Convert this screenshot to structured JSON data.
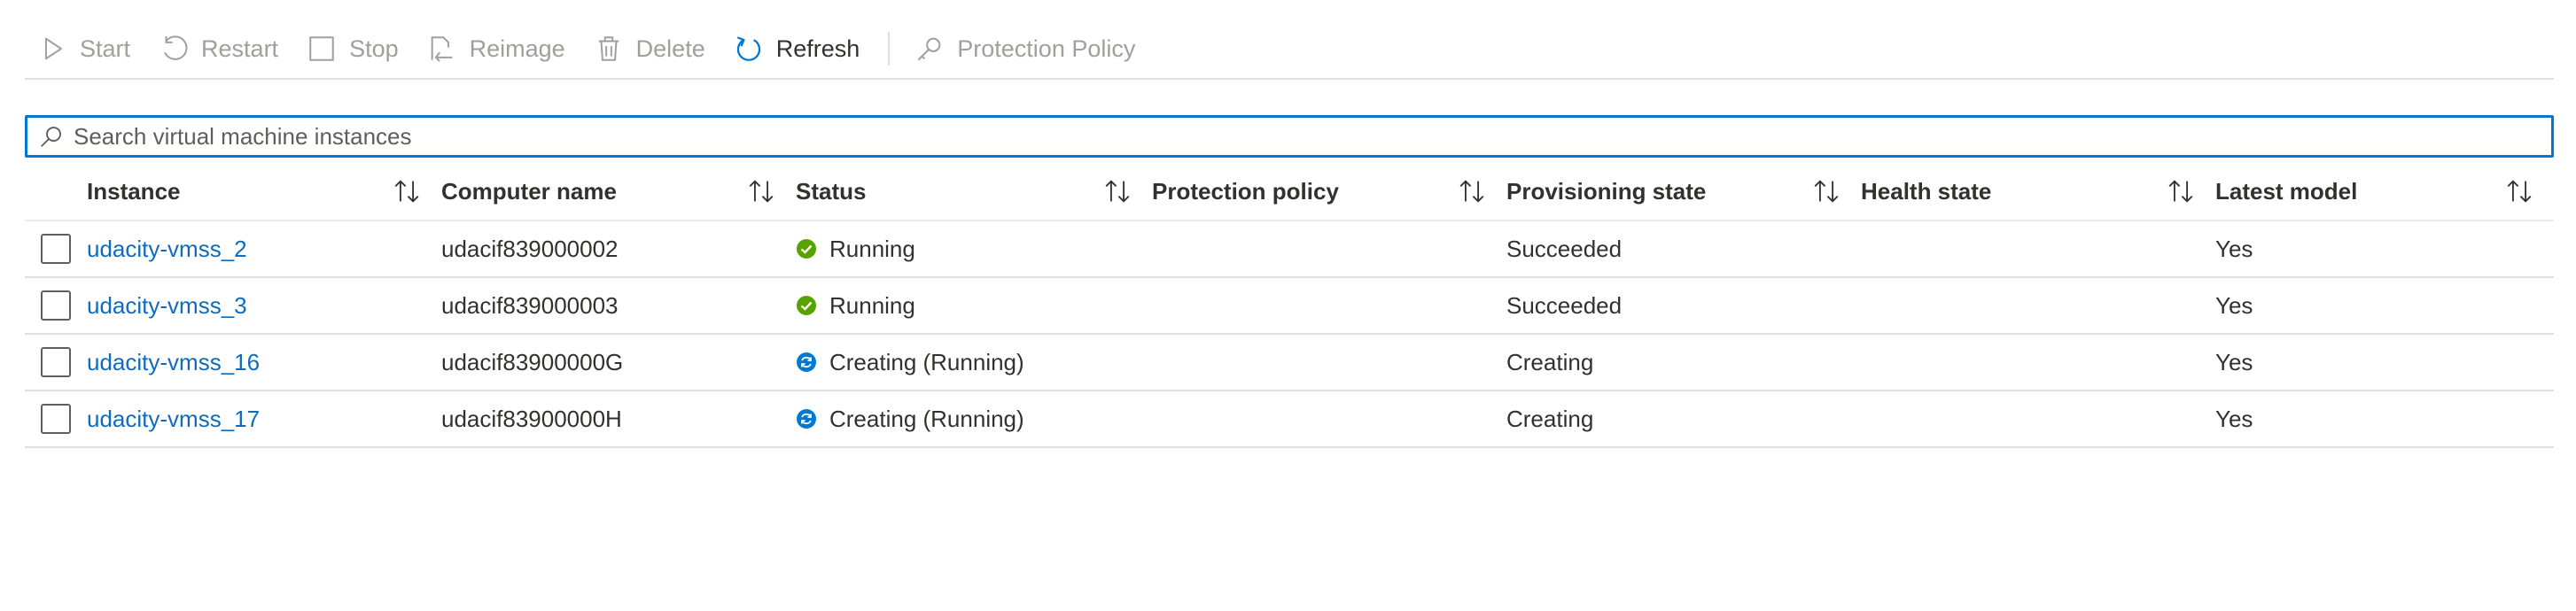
{
  "toolbar": {
    "start": "Start",
    "restart": "Restart",
    "stop": "Stop",
    "reimage": "Reimage",
    "delete": "Delete",
    "refresh": "Refresh",
    "protection_policy": "Protection Policy"
  },
  "search": {
    "placeholder": "Search virtual machine instances",
    "value": ""
  },
  "table": {
    "headers": {
      "instance": "Instance",
      "computer_name": "Computer name",
      "status": "Status",
      "protection_policy": "Protection policy",
      "provisioning_state": "Provisioning state",
      "health_state": "Health state",
      "latest_model": "Latest model"
    },
    "rows": [
      {
        "instance": "udacity-vmss_2",
        "computer_name": "udacif839000002",
        "status": "Running",
        "status_kind": "running",
        "protection_policy": "",
        "provisioning_state": "Succeeded",
        "health_state": "",
        "latest_model": "Yes"
      },
      {
        "instance": "udacity-vmss_3",
        "computer_name": "udacif839000003",
        "status": "Running",
        "status_kind": "running",
        "protection_policy": "",
        "provisioning_state": "Succeeded",
        "health_state": "",
        "latest_model": "Yes"
      },
      {
        "instance": "udacity-vmss_16",
        "computer_name": "udacif83900000G",
        "status": "Creating (Running)",
        "status_kind": "creating",
        "protection_policy": "",
        "provisioning_state": "Creating",
        "health_state": "",
        "latest_model": "Yes"
      },
      {
        "instance": "udacity-vmss_17",
        "computer_name": "udacif83900000H",
        "status": "Creating (Running)",
        "status_kind": "creating",
        "protection_policy": "",
        "provisioning_state": "Creating",
        "health_state": "",
        "latest_model": "Yes"
      }
    ]
  },
  "colors": {
    "accent": "#0078d4",
    "link": "#0f6cbd",
    "running": "#57a300",
    "creating": "#0078d4",
    "disabled_text": "#a19f9d"
  }
}
